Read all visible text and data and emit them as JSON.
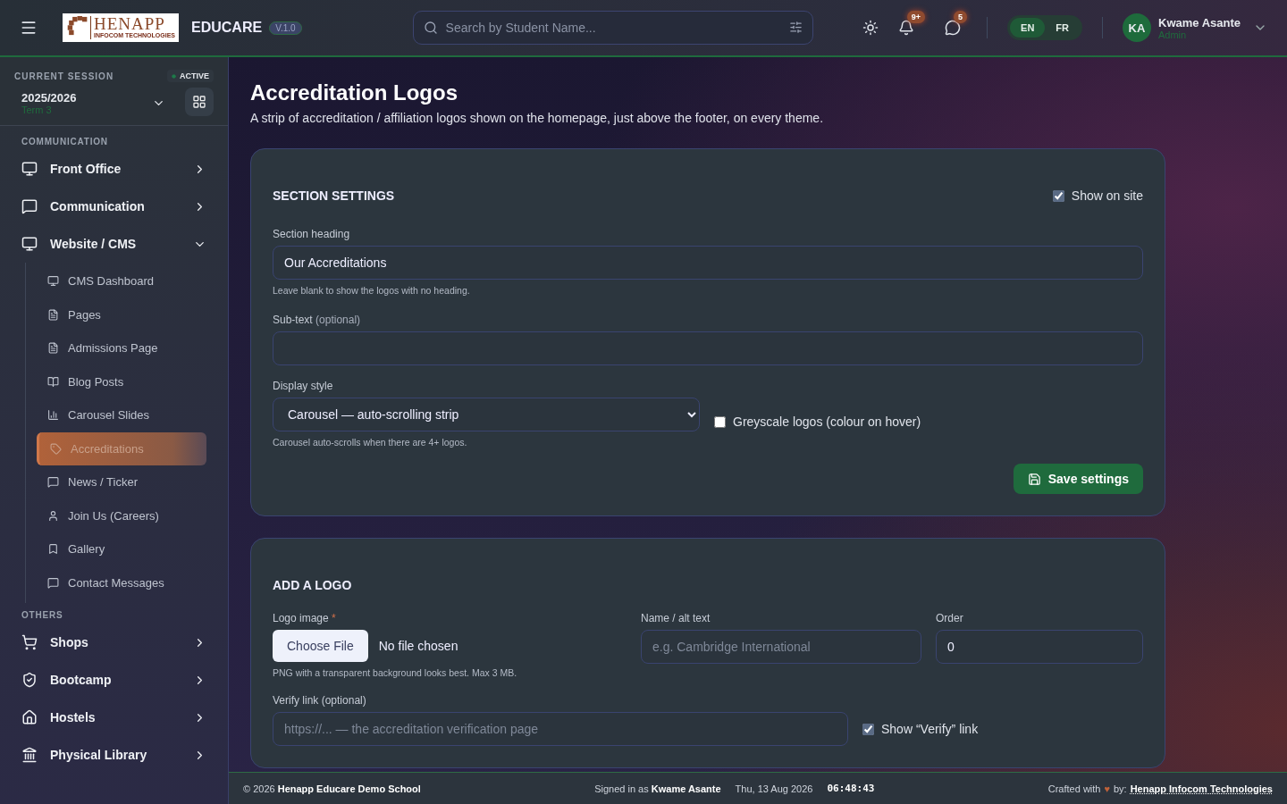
{
  "header": {
    "logo": {
      "name": "HENAPP",
      "tagline": "INFOCOM TECHNOLOGIES"
    },
    "app_name": "EDUCARE",
    "version": "V.1.0",
    "search": {
      "placeholder": "Search by Student Name..."
    },
    "notifications": "9+",
    "messages": "5",
    "languages": [
      {
        "label": "EN",
        "selected": true
      },
      {
        "label": "FR",
        "selected": false
      }
    ],
    "user": {
      "initials": "KA",
      "name": "Kwame Asante",
      "role": "Admin"
    }
  },
  "session": {
    "label": "CURRENT SESSION",
    "status": "ACTIVE",
    "year": "2025/2026",
    "term": "Term 3"
  },
  "sidebar": [
    {
      "kind": "heading",
      "label": "COMMUNICATION"
    },
    {
      "kind": "item",
      "label": "Front Office",
      "expanded": false
    },
    {
      "kind": "item",
      "label": "Communication",
      "expanded": false
    },
    {
      "kind": "item",
      "label": "Website / CMS",
      "expanded": true,
      "children": [
        {
          "label": "CMS Dashboard",
          "selected": false
        },
        {
          "label": "Pages",
          "selected": false
        },
        {
          "label": "Admissions Page",
          "selected": false
        },
        {
          "label": "Blog Posts",
          "selected": false
        },
        {
          "label": "Carousel Slides",
          "selected": false
        },
        {
          "label": "Accreditations",
          "selected": true
        },
        {
          "label": "News / Ticker",
          "selected": false
        },
        {
          "label": "Join Us (Careers)",
          "selected": false
        },
        {
          "label": "Gallery",
          "selected": false
        },
        {
          "label": "Contact Messages",
          "selected": false
        }
      ]
    },
    {
      "kind": "heading",
      "label": "OTHERS"
    },
    {
      "kind": "item",
      "label": "Shops",
      "expanded": false
    },
    {
      "kind": "item",
      "label": "Bootcamp",
      "expanded": false
    },
    {
      "kind": "item",
      "label": "Hostels",
      "expanded": false
    },
    {
      "kind": "item",
      "label": "Physical Library",
      "expanded": false
    }
  ],
  "page": {
    "title": "Accreditation Logos",
    "subtitle": "A strip of accreditation / affiliation logos shown on the homepage, just above the footer, on every theme."
  },
  "section_settings": {
    "title": "SECTION SETTINGS",
    "show_on_site": {
      "label": "Show on site",
      "checked": true
    },
    "heading_field": {
      "label": "Section heading",
      "value": "Our Accreditations",
      "help": "Leave blank to show the logos with no heading."
    },
    "subtext_field": {
      "label": "Sub-text",
      "label_note": "(optional)"
    },
    "display_style": {
      "label": "Display style",
      "value": "Carousel — auto-scrolling strip",
      "help": "Carousel auto-scrolls when there are 4+ logos."
    },
    "greyscale": {
      "label": "Greyscale logos (colour on hover)",
      "checked": false
    },
    "save": "Save settings"
  },
  "add_logo": {
    "title": "ADD A LOGO",
    "image": {
      "label": "Logo image",
      "required": "*",
      "button": "Choose File",
      "status": "No file chosen",
      "help": "PNG with a transparent background looks best. Max 3 MB."
    },
    "name": {
      "label": "Name / alt text",
      "placeholder": "e.g. Cambridge International"
    },
    "order": {
      "label": "Order",
      "value": "0"
    },
    "verify": {
      "label": "Verify link (optional)",
      "placeholder": "https://... — the accreditation verification page"
    },
    "show_verify": {
      "label": "Show “Verify” link",
      "checked": true
    }
  },
  "footer": {
    "copyright": "© 2026 **Henapp Educare Demo School**",
    "signed_in": "Signed in as **Kwame Asante**",
    "date": "Thu, 13 Aug 2026",
    "time": "06:48:43",
    "crafted_prefix": "Crafted with",
    "heart": "♥",
    "crafted_suffix": "by:",
    "crafted_by": "Henapp Infocom Technologies"
  }
}
